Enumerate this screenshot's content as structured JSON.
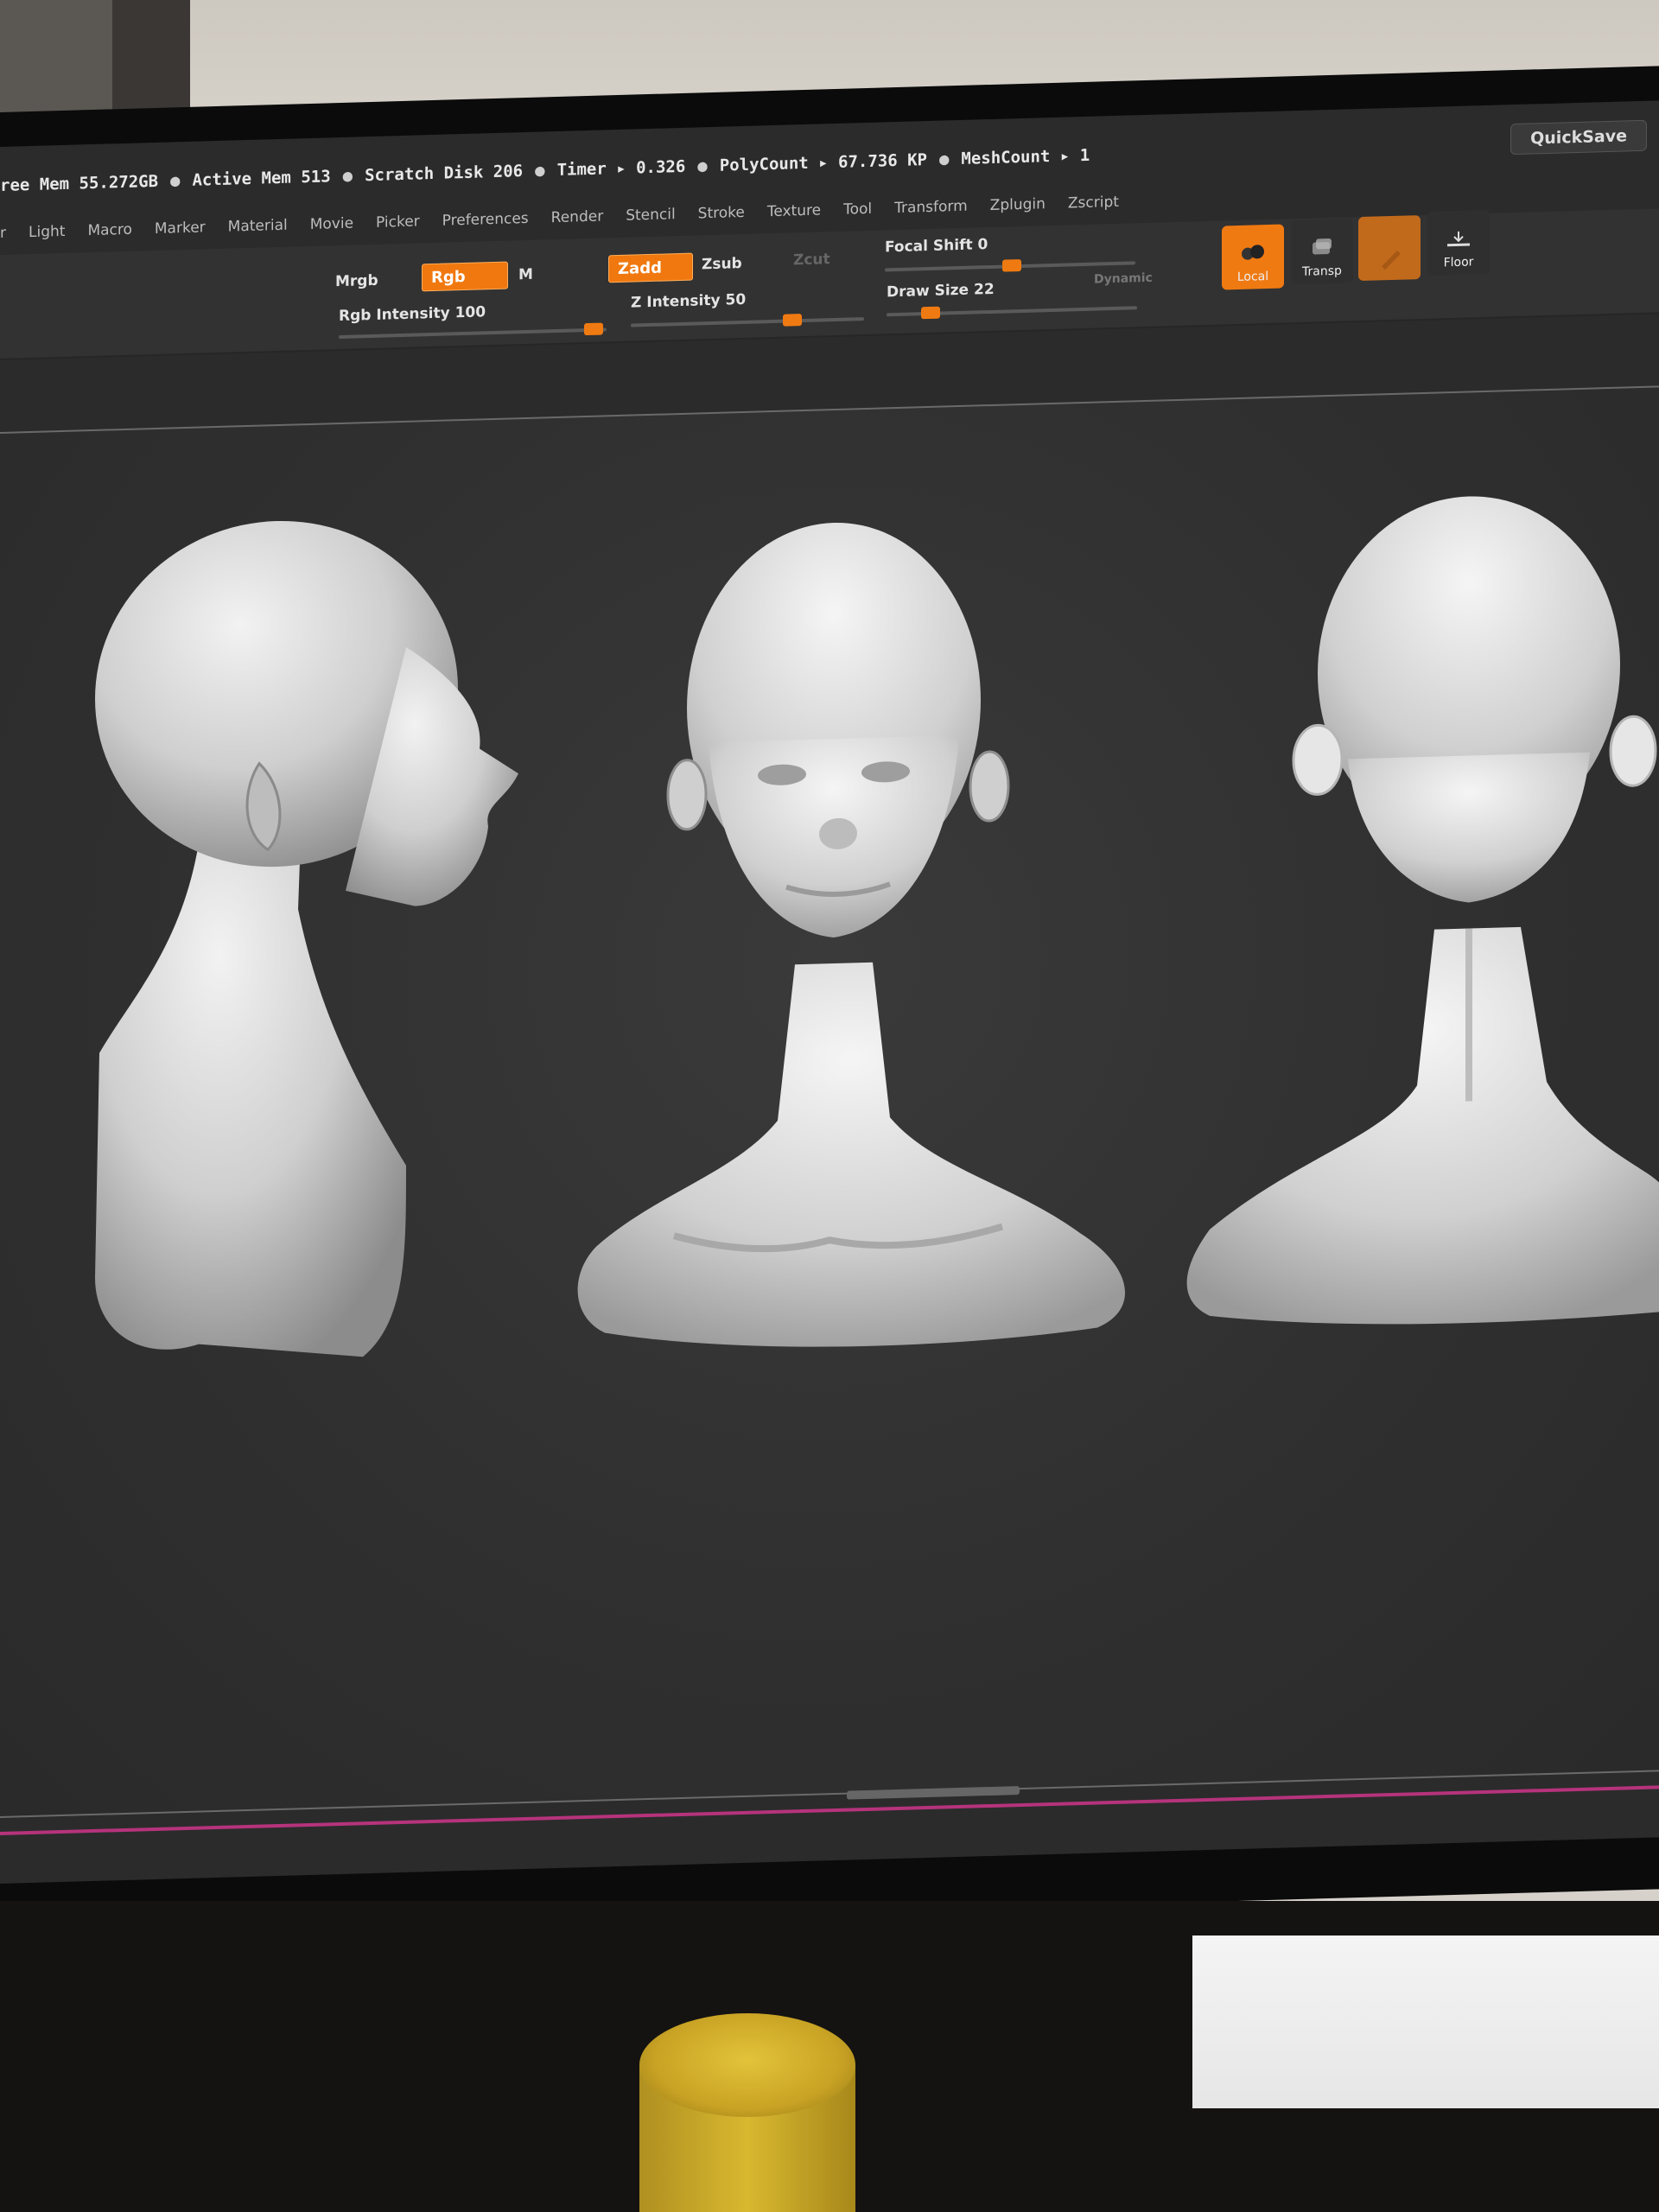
{
  "app": {
    "status": [
      "ree Mem 55.272GB",
      "Active Mem 513",
      "Scratch Disk 206",
      "Timer ▸ 0.326",
      "PolyCount ▸ 67.736  KP",
      "MeshCount ▸ 1"
    ],
    "quicksave_label": "QuickSave"
  },
  "menu": [
    "r",
    "Light",
    "Macro",
    "Marker",
    "Material",
    "Movie",
    "Picker",
    "Preferences",
    "Render",
    "Stencil",
    "Stroke",
    "Texture",
    "Tool",
    "Transform",
    "Zplugin",
    "Zscript"
  ],
  "shelf": {
    "mrgb_label": "Mrgb",
    "rgb_label": "Rgb",
    "m_label": "M",
    "zadd_label": "Zadd",
    "zsub_label": "Zsub",
    "zcut_label": "Zcut",
    "rgb_intensity_label": "Rgb Intensity 100",
    "rgb_intensity_value": 100,
    "z_intensity_label": "Z Intensity 50",
    "z_intensity_value": 50,
    "focal_shift_label": "Focal Shift 0",
    "focal_shift_value": 0,
    "draw_size_label": "Draw Size 22",
    "draw_size_value": 22,
    "dynamic_label": "Dynamic",
    "local_label": "Local",
    "transp_label": "Transp",
    "floor_label": "Floor"
  },
  "colors": {
    "accent": "#f07a12",
    "ui_bg": "#2b2b2b",
    "model_gray": "#d8d8d8"
  }
}
